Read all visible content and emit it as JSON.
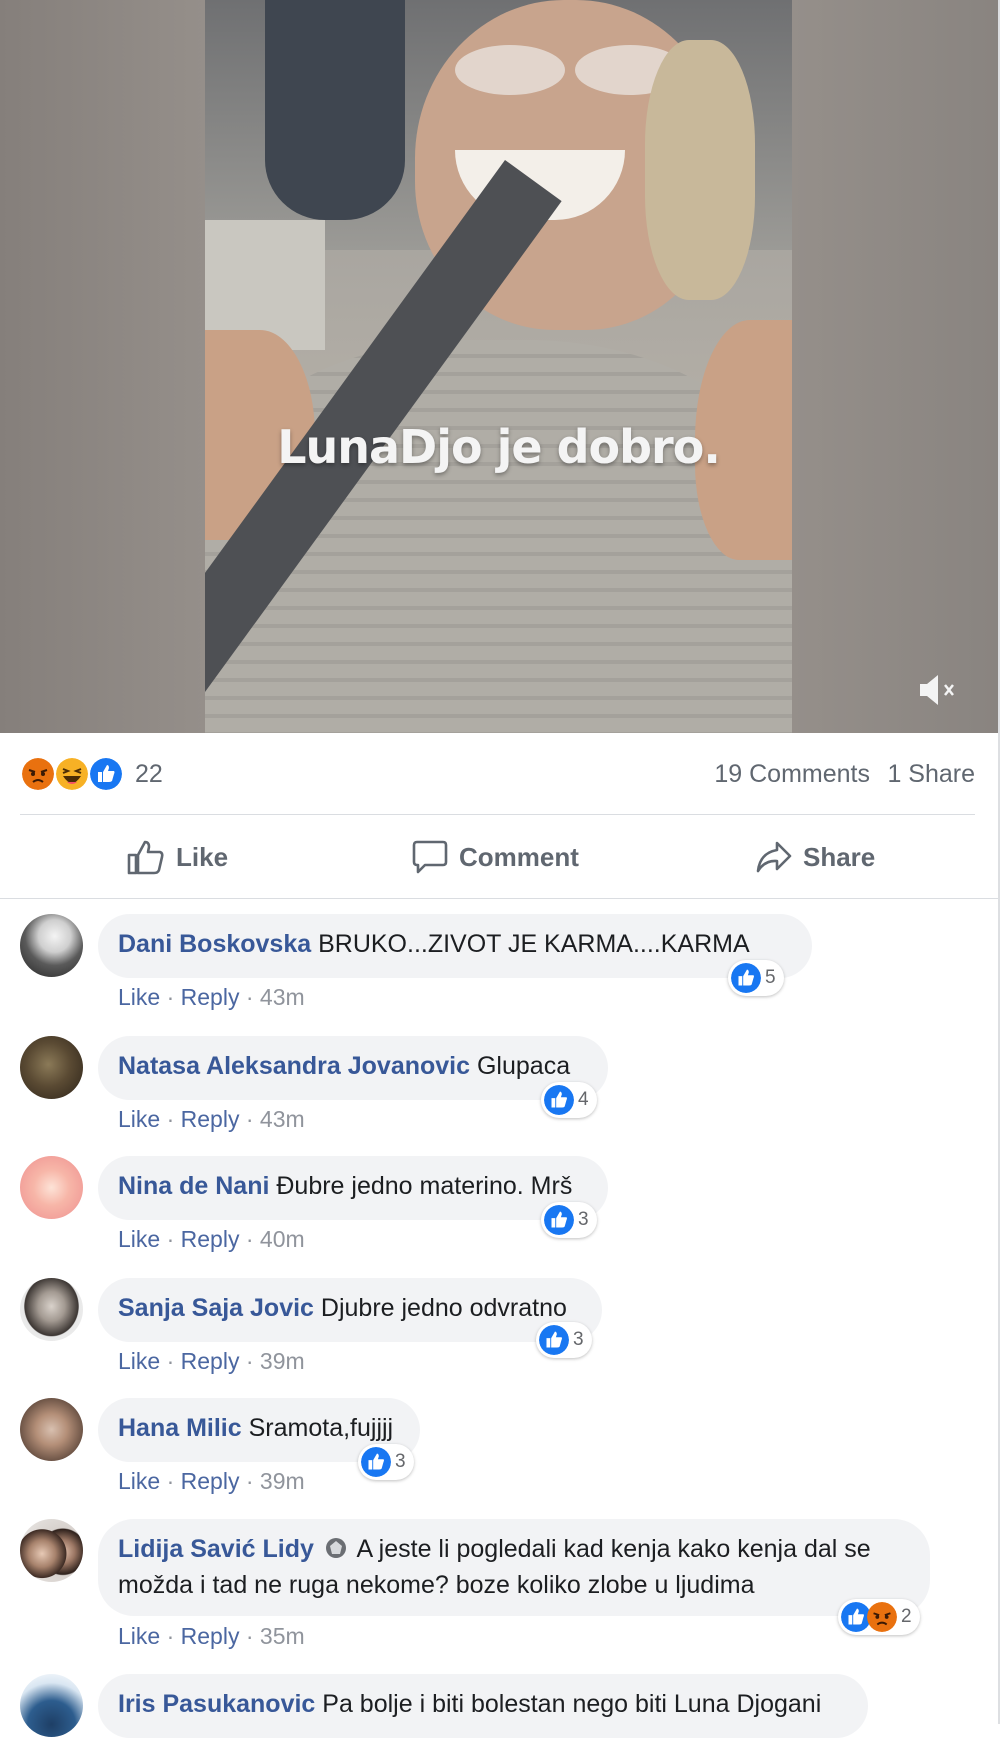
{
  "video": {
    "caption": "LunaDjo je dobro.",
    "mute_icon": "speaker-muted-icon"
  },
  "summary": {
    "reaction_icons": [
      "angry-reaction-icon",
      "haha-reaction-icon",
      "like-reaction-icon"
    ],
    "reaction_count": "22",
    "comments_label": "19 Comments",
    "shares_label": "1 Share"
  },
  "actions": {
    "like_label": "Like",
    "comment_label": "Comment",
    "share_label": "Share"
  },
  "colors": {
    "like_blue": "#1877f2",
    "angry_orange": "#e9710f",
    "haha_yellow": "#f7b125",
    "author_blue": "#385898",
    "meta_gray": "#90949c",
    "bubble_gray": "#f2f3f5"
  },
  "comment_meta": {
    "like_label": "Like",
    "reply_label": "Reply",
    "separator": " · "
  },
  "comments": [
    {
      "author": "Dani Boskovska",
      "text": "BRUKO...ZIVOT JE KARMA....KARMA",
      "time": "43m",
      "reactions": "5"
    },
    {
      "author": "Natasa Aleksandra Jovanovic",
      "text": "Glupaca",
      "time": "43m",
      "reactions": "4"
    },
    {
      "author": "Nina de Nani",
      "text": "Đubre jedno materino. Mrš",
      "time": "40m",
      "reactions": "3"
    },
    {
      "author": "Sanja Saja Jovic",
      "text": "Djubre jedno odvratno",
      "time": "39m",
      "reactions": "3"
    },
    {
      "author": "Hana Milic",
      "text": "Sramota,fujjjj",
      "time": "39m",
      "reactions": "3"
    },
    {
      "author": "Lidija Savić Lidy",
      "badge_icon": "top-fan-badge-icon",
      "text_line1": "A jeste li pogledali kad kenja kako kenja dal se",
      "text_line2": "možda i tad ne ruga nekome? boze koliko zlobe u ljudima",
      "time": "35m",
      "reactions": "2"
    },
    {
      "author": "Iris Pasukanovic",
      "text": "Pa bolje i biti bolestan nego biti Luna Djogani"
    }
  ]
}
